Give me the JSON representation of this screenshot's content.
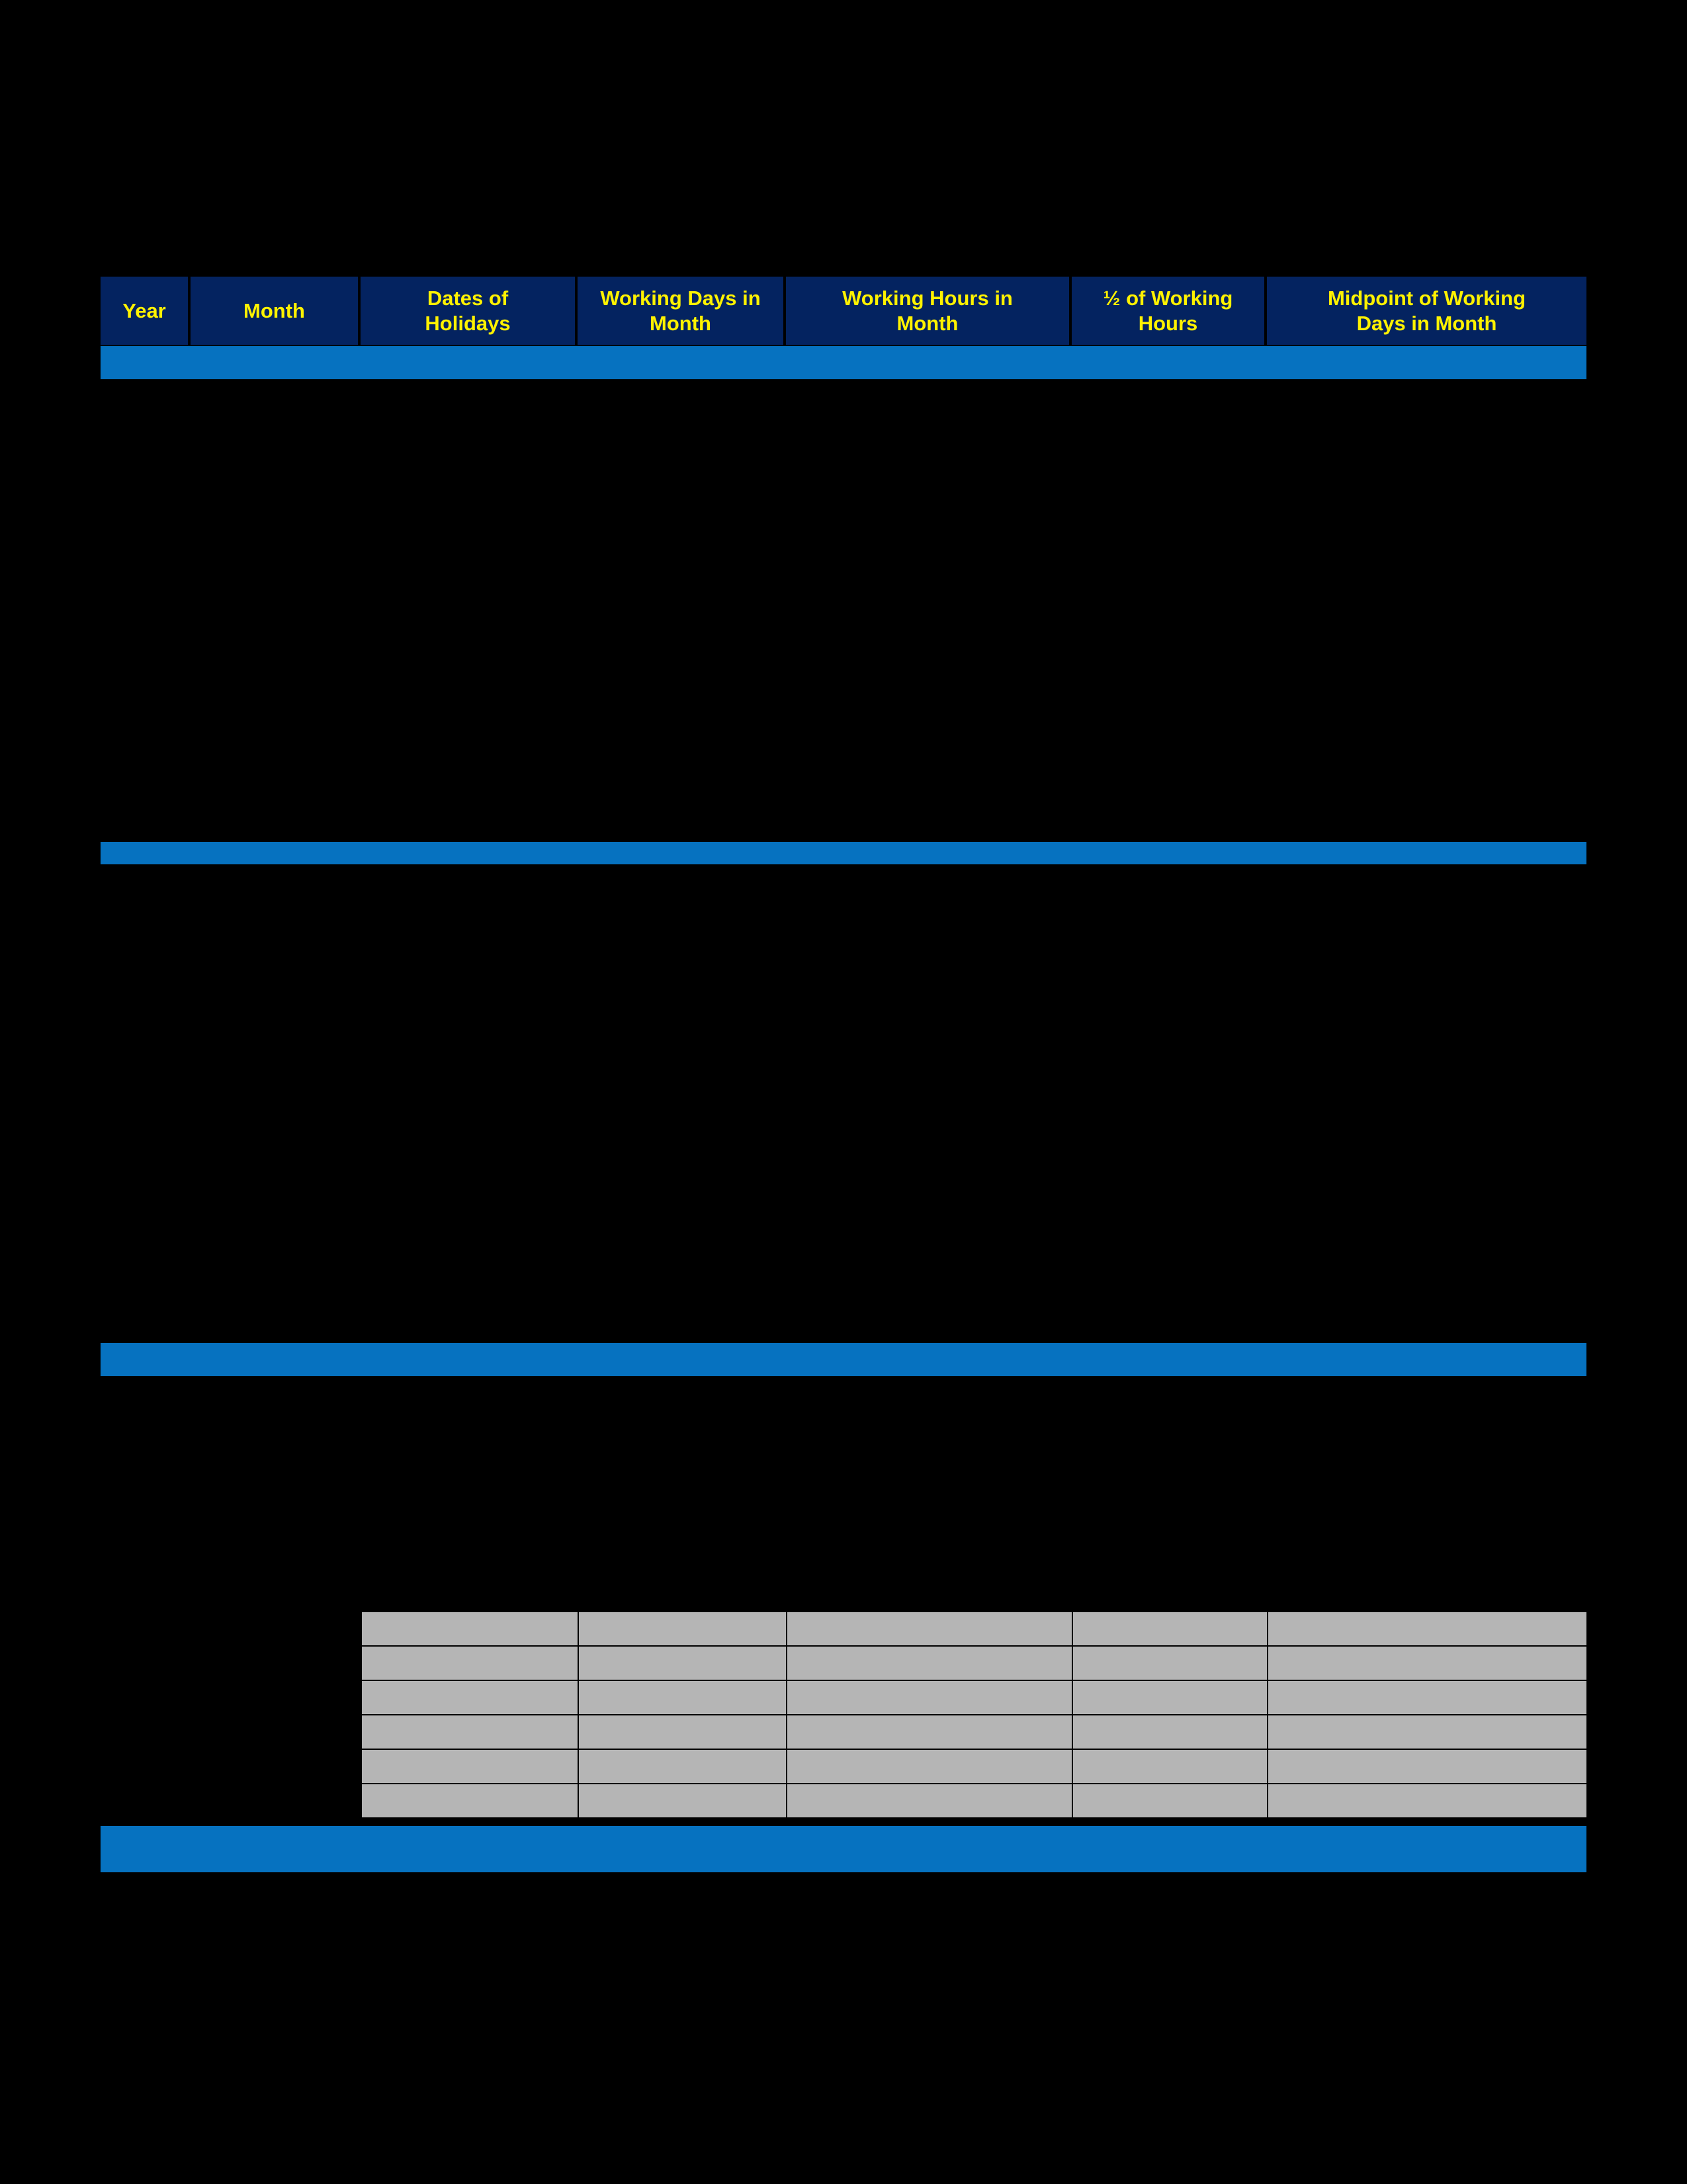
{
  "page": {
    "background_color": "#000000",
    "accent_blue": "#0672C0",
    "header_navy": "#042360",
    "header_text_color": "#FFF200",
    "grid_cell_gray": "#B5B5B5",
    "grid_border_color": "#000000"
  },
  "table": {
    "columns": [
      {
        "label": "Year"
      },
      {
        "label": "Month"
      },
      {
        "label": "Dates of\nHolidays"
      },
      {
        "label": "Working Days in\nMonth"
      },
      {
        "label": "Working Hours in\nMonth"
      },
      {
        "label": "½ of Working\nHours"
      },
      {
        "label": "Midpoint of Working\nDays in Month"
      }
    ],
    "header_line1": [
      "Year",
      "Month",
      "Dates of",
      "Working Days in",
      "Working Hours in",
      "½ of Working",
      "Midpoint of Working"
    ],
    "header_line2": [
      "",
      "",
      "Holidays",
      "Month",
      "Month",
      "Hours",
      "Days in Month"
    ]
  },
  "separators": [
    {
      "name": "blue-bar-1"
    },
    {
      "name": "blue-bar-2"
    },
    {
      "name": "blue-bar-3"
    },
    {
      "name": "blue-bar-4"
    }
  ],
  "data_grid": {
    "column_count": 5,
    "row_count": 6,
    "rows": [
      [
        "",
        "",
        "",
        "",
        ""
      ],
      [
        "",
        "",
        "",
        "",
        ""
      ],
      [
        "",
        "",
        "",
        "",
        ""
      ],
      [
        "",
        "",
        "",
        "",
        ""
      ],
      [
        "",
        "",
        "",
        "",
        ""
      ],
      [
        "",
        "",
        "",
        "",
        ""
      ]
    ]
  }
}
